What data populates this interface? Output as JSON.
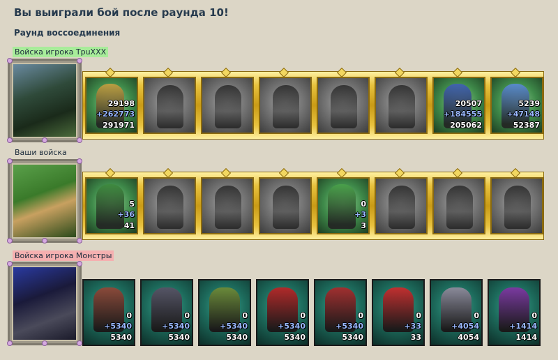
{
  "title": "Вы выиграли бой после раунда 10!",
  "subtitle": "Раунд воссоединения",
  "armies": [
    {
      "label": "Войска игрока TpuXXX",
      "label_style": "green",
      "hero_icon": "hero-portrait-witch",
      "units": [
        {
          "icon": "crusader-icon",
          "state": "active",
          "count": "29198",
          "bonus": "+262773",
          "total": "291971",
          "color": "#c8a040"
        },
        {
          "icon": "knight-icon",
          "state": "inactive"
        },
        {
          "icon": "cavalier-icon",
          "state": "inactive"
        },
        {
          "icon": "griffin-icon",
          "state": "inactive"
        },
        {
          "icon": "crossbowman-icon",
          "state": "inactive"
        },
        {
          "icon": "monk-icon",
          "state": "inactive"
        },
        {
          "icon": "paladin-icon",
          "state": "active",
          "count": "20507",
          "bonus": "+184555",
          "total": "205062",
          "color": "#4060b8"
        },
        {
          "icon": "archmage-icon",
          "state": "active",
          "count": "5239",
          "bonus": "+47148",
          "total": "52387",
          "color": "#5a8ad8"
        }
      ]
    },
    {
      "label": "Ваши войска",
      "label_style": "plain",
      "hero_icon": "hero-portrait-ranger",
      "units": [
        {
          "icon": "dwarf-icon",
          "state": "active",
          "count": "5",
          "bonus": "+36",
          "total": "41",
          "color": "#3e8a3e"
        },
        {
          "icon": "dark-knight-icon",
          "state": "inactive"
        },
        {
          "icon": "legionnaire-icon",
          "state": "inactive"
        },
        {
          "icon": "gargoyle-icon",
          "state": "inactive"
        },
        {
          "icon": "elf-archer-icon",
          "state": "active",
          "count": "0",
          "bonus": "+3",
          "total": "3",
          "color": "#4aa24a"
        },
        {
          "icon": "priestess-icon",
          "state": "inactive"
        },
        {
          "icon": "golem-icon",
          "state": "inactive"
        },
        {
          "icon": "wizard-icon",
          "state": "inactive"
        }
      ]
    },
    {
      "label": "Войска игрока Монстры",
      "label_style": "pink",
      "hero_icon": "hero-portrait-beast",
      "units": [
        {
          "icon": "dragon-beast-icon",
          "count": "0",
          "bonus": "+5340",
          "total": "5340",
          "color": "#8a4a3a"
        },
        {
          "icon": "armored-ogre-icon",
          "count": "0",
          "bonus": "+5340",
          "total": "5340",
          "color": "#555566"
        },
        {
          "icon": "orc-shaman-icon",
          "count": "0",
          "bonus": "+5340",
          "total": "5340",
          "color": "#6a8a3a"
        },
        {
          "icon": "demon-icon",
          "count": "0",
          "bonus": "+5340",
          "total": "5340",
          "color": "#b02a2a"
        },
        {
          "icon": "scorpion-icon",
          "count": "0",
          "bonus": "+5340",
          "total": "5340",
          "color": "#a03030"
        },
        {
          "icon": "red-devil-icon",
          "count": "0",
          "bonus": "+33",
          "total": "33",
          "color": "#c03030"
        },
        {
          "icon": "war-machine-icon",
          "count": "0",
          "bonus": "+4054",
          "total": "4054",
          "color": "#8a8a9a"
        },
        {
          "icon": "sorceress-icon",
          "count": "0",
          "bonus": "+1414",
          "total": "1414",
          "color": "#7a3aa0"
        }
      ]
    }
  ]
}
